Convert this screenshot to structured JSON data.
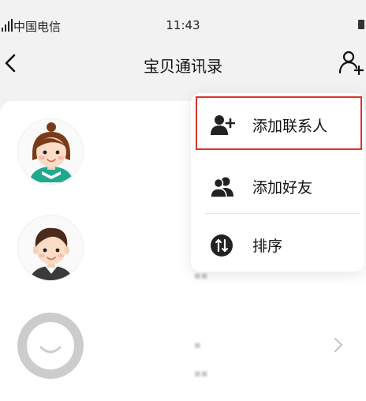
{
  "status_bar": {
    "carrier": "中国电信",
    "time": "11:43"
  },
  "nav": {
    "title": "宝贝通讯录",
    "back_icon": "chevron-left-icon",
    "add_icon": "add-contact-icon"
  },
  "contacts": [
    {
      "avatar": "girl-avatar"
    },
    {
      "avatar": "boy-avatar"
    },
    {
      "avatar": "default-avatar"
    }
  ],
  "menu": {
    "items": [
      {
        "label": "添加联系人",
        "icon": "add-contact-icon",
        "highlighted": true
      },
      {
        "label": "添加好友",
        "icon": "friends-icon",
        "highlighted": false
      },
      {
        "label": "排序",
        "icon": "sort-icon",
        "highlighted": false
      }
    ]
  },
  "colors": {
    "highlight_border": "#d9342b",
    "background": "#f2f2f2"
  }
}
